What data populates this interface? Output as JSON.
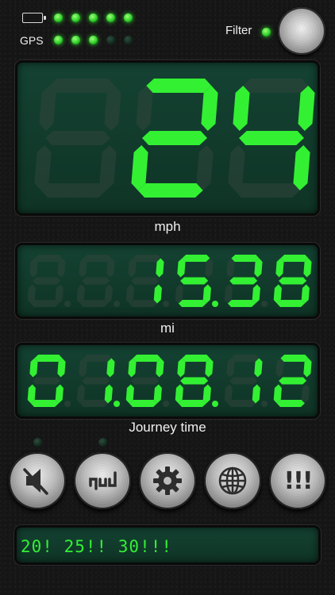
{
  "status": {
    "gps_label": "GPS",
    "battery_leds": [
      true,
      true,
      true,
      true,
      true
    ],
    "gps_leds": [
      true,
      true,
      true,
      false,
      false
    ],
    "battery_icon": "battery-icon"
  },
  "filter": {
    "label": "Filter",
    "led_on": true,
    "knob_icon": "filter-knob"
  },
  "speed": {
    "digits": [
      "8",
      "2",
      "4"
    ],
    "digits_lit": [
      false,
      true,
      true
    ],
    "unit": "mph"
  },
  "distance": {
    "digits": [
      "8",
      "8",
      "1",
      "5",
      "3",
      "8"
    ],
    "digits_lit": [
      false,
      false,
      true,
      true,
      true,
      true
    ],
    "dots_lit": [
      false,
      false,
      false,
      true,
      false
    ],
    "unit": "mi"
  },
  "journey": {
    "digits": [
      "0",
      "1",
      "0",
      "8",
      "1",
      "2"
    ],
    "digits_lit": [
      true,
      true,
      true,
      true,
      true,
      true
    ],
    "dots_lit": [
      false,
      true,
      false,
      true,
      false
    ],
    "label": "Journey time"
  },
  "controls": {
    "indicator_leds": [
      false,
      false
    ],
    "buttons": [
      {
        "name": "mute",
        "icon": "speaker-mute-icon"
      },
      {
        "name": "display-mode",
        "icon": "hud-icon"
      },
      {
        "name": "settings",
        "icon": "gear-icon"
      },
      {
        "name": "web",
        "icon": "globe-icon"
      },
      {
        "name": "alerts",
        "icon": "exclamation-icon",
        "text": "!!!"
      }
    ]
  },
  "ticker": {
    "text": "20! 25!! 30!!!"
  },
  "colors": {
    "lit_segment": "#33f033",
    "unlit_segment": "#32463c",
    "panel": "#144232"
  }
}
